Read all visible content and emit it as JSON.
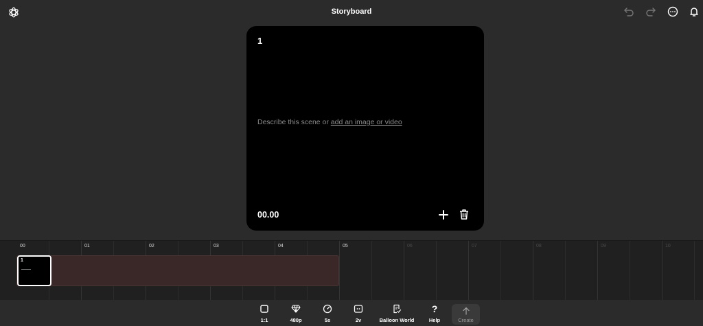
{
  "app": {
    "title": "Storyboard"
  },
  "topbar": {
    "icons": [
      "openai-logo-icon",
      "undo-icon",
      "redo-icon",
      "more-icon",
      "bell-icon"
    ]
  },
  "scene": {
    "number": "1",
    "prompt_text": "Describe this scene or ",
    "prompt_link": "add an image or video",
    "timecode": "00.00"
  },
  "timeline": {
    "ticks": [
      "00",
      "01",
      "02",
      "03",
      "04",
      "05",
      "06",
      "07",
      "08",
      "09",
      "10"
    ],
    "clip": {
      "number": "1"
    }
  },
  "toolbar": {
    "aspect": "1:1",
    "resolution": "480p",
    "duration": "5s",
    "variations": "2v",
    "preset": "Balloon World",
    "help": "Help",
    "create": "Create"
  },
  "colors": {
    "background": "#2b2b2b",
    "canvas": "#000000",
    "timeline": "#202020",
    "clip": "#3a2727"
  }
}
